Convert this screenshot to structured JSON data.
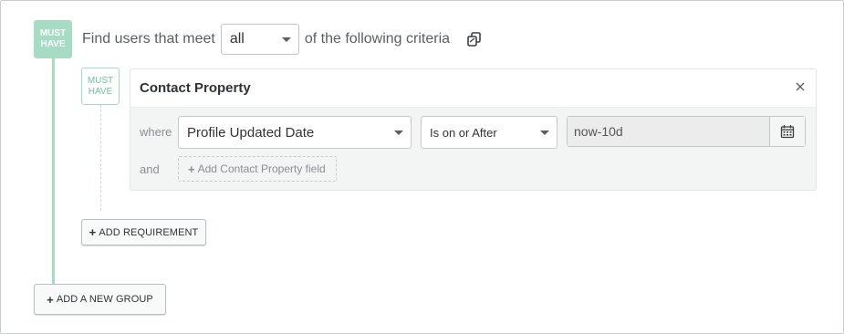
{
  "group": {
    "badge_line1": "MUST",
    "badge_line2": "HAVE",
    "prefix_text": "Find users that meet",
    "match_value": "all",
    "suffix_text": "of the following criteria",
    "copy_icon": "copy-icon"
  },
  "requirement": {
    "badge_line1": "MUST",
    "badge_line2": "HAVE",
    "card": {
      "title": "Contact Property",
      "close_icon": "close-icon",
      "where_label": "where",
      "property_value": "Profile Updated Date",
      "operator_value": "Is on or After",
      "date_value": "now-10d",
      "calendar_icon": "calendar-icon",
      "and_label": "and",
      "add_field_label": "Add Contact Property field"
    }
  },
  "buttons": {
    "add_requirement": "ADD REQUIREMENT",
    "add_group": "ADD A NEW GROUP"
  },
  "colors": {
    "accent_green": "#a7dcc4",
    "accent_green_text": "#6cc39e"
  }
}
